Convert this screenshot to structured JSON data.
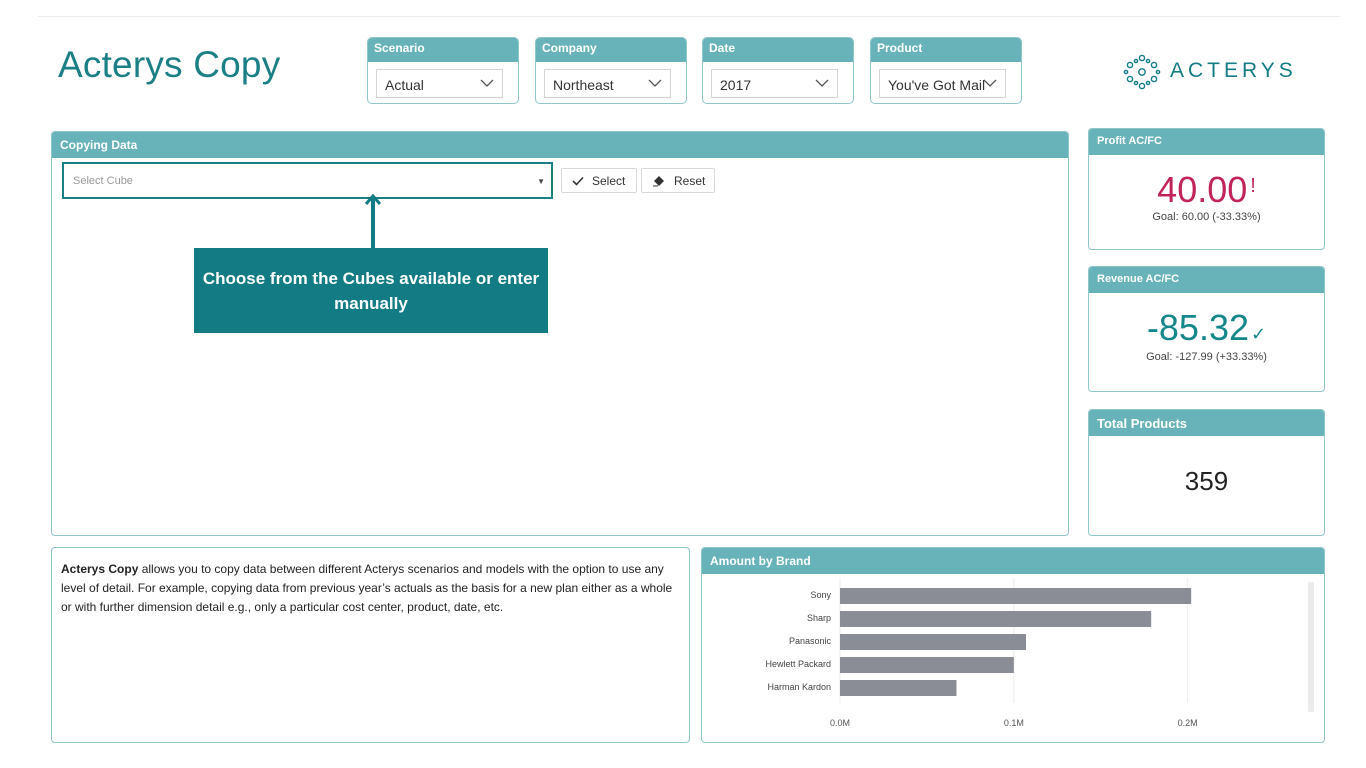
{
  "app": {
    "title": "Acterys Copy"
  },
  "slicers": [
    {
      "label": "Scenario",
      "value": "Actual"
    },
    {
      "label": "Company",
      "value": "Northeast"
    },
    {
      "label": "Date",
      "value": "2017"
    },
    {
      "label": "Product",
      "value": "You've Got Mail"
    }
  ],
  "logo": {
    "text": "ACTERYS"
  },
  "copy_panel": {
    "title": "Copying Data",
    "cube_placeholder": "Select Cube",
    "select_label": "Select",
    "reset_label": "Reset",
    "callout": "Choose from the Cubes  available or enter manually"
  },
  "kpis": {
    "profit": {
      "title": "Profit AC/FC",
      "value": "40.00",
      "flag": "!",
      "goal": "Goal: 60.00 (-33.33%)",
      "color": "#c0245a"
    },
    "revenue": {
      "title": "Revenue AC/FC",
      "value": "-85.32",
      "flag": "✓",
      "goal": "Goal: -127.99 (+33.33%)",
      "color": "#15878b"
    },
    "total": {
      "title": "Total Products",
      "value": "359"
    }
  },
  "description": {
    "bold": "Acterys Copy",
    "text": " allows you to copy data between different Acterys scenarios and models with the option to use any level of detail. For example, copying data from previous year’s actuals as the basis for a new plan either as a whole or with further dimension detail e.g., only a particular cost center, product, date, etc."
  },
  "chart_title": "Amount by Brand",
  "chart_data": {
    "type": "bar",
    "orientation": "horizontal",
    "title": "Amount by Brand",
    "categories": [
      "Sony",
      "Sharp",
      "Panasonic",
      "Hewlett Packard",
      "Harman Kardon"
    ],
    "values": [
      0.202,
      0.179,
      0.107,
      0.1,
      0.067
    ],
    "unit": "M",
    "xlim": [
      0,
      0.26
    ],
    "ticks": [
      0,
      0.1,
      0.2
    ],
    "tick_labels": [
      "0.0M",
      "0.1M",
      "0.2M"
    ],
    "grid": true,
    "bar_color": "#8a8d96"
  }
}
